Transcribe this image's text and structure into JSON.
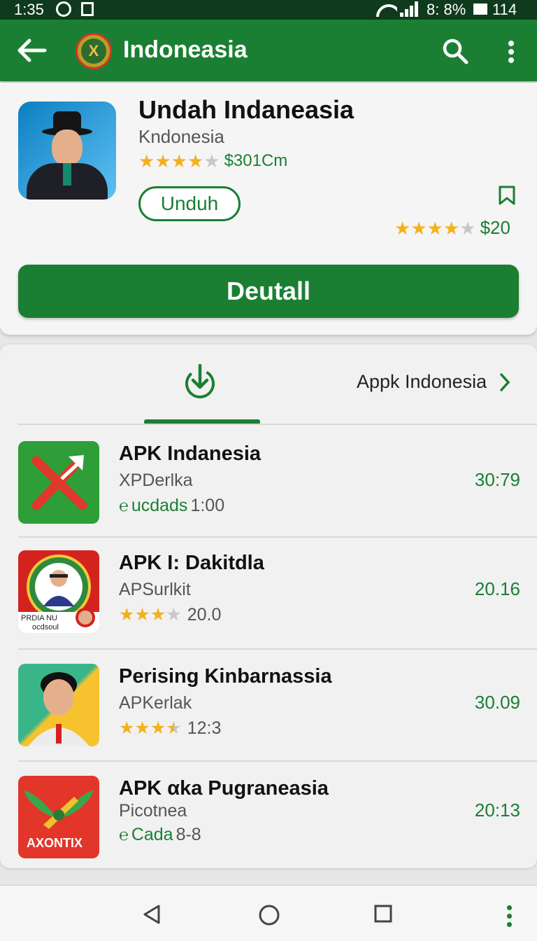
{
  "status_bar": {
    "time": "1:35",
    "battery_text": "8: 8%",
    "battery_level": "114"
  },
  "app_bar": {
    "title": "Indoneasia",
    "back_icon": "arrow-left-icon",
    "search_icon": "search-icon",
    "more_icon": "more-vertical-icon"
  },
  "header": {
    "app_title": "Undah Indaneasia",
    "app_subtitle": "Kndonesia",
    "rating_stars": 4,
    "rating_text": "$301Cm",
    "install_label": "Unduh",
    "right_rating_stars": 4,
    "right_price": "$20",
    "detail_button_label": "Deutall"
  },
  "tabs": {
    "download_icon": "download-icon",
    "appk_label": "Appk Indonesia"
  },
  "list": [
    {
      "title": "APK Indanesia",
      "subtitle": "XPDerlka",
      "meta_prefix": "ucdads",
      "meta_value": "1:00",
      "meta_type": "link",
      "stars": null,
      "right_value": "30:79"
    },
    {
      "title": "APK I: Dakitdla",
      "subtitle": "APSurlkit",
      "meta_prefix": "",
      "meta_value": "20.0",
      "meta_type": "stars",
      "stars": 3,
      "right_value": "20.16"
    },
    {
      "title": "Perising Kinbarnassia",
      "subtitle": "APKerlak",
      "meta_prefix": "",
      "meta_value": "12:3",
      "meta_type": "stars",
      "stars": 3.5,
      "right_value": "30.09"
    },
    {
      "title": "APK αka Pugraneasia",
      "subtitle": "Picotnea",
      "meta_prefix": "Cada",
      "meta_value": "8-8",
      "meta_type": "link",
      "stars": null,
      "right_value": "20:13"
    }
  ],
  "icon_texts": {
    "row2_badge_text": "PRDIA NU",
    "row2_badge_text2": "ocdsoul",
    "row4_text": "AXONTIX"
  },
  "colors": {
    "primary": "#1b7f33",
    "status_bar": "#0f3a1d",
    "star": "#f2b21c"
  },
  "nav": {
    "back": "nav-back-icon",
    "home": "nav-home-icon",
    "recents": "nav-recents-icon"
  }
}
